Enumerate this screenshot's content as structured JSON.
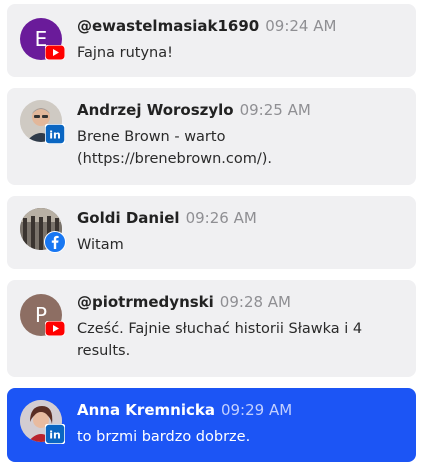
{
  "messages": [
    {
      "author": "@ewastelmasiak1690",
      "time": "09:24 AM",
      "text": "Fajna rutyna!",
      "avatar_letter": "E",
      "avatar_color": "#6a1b9a",
      "platform": "youtube-icon"
    },
    {
      "author": "Andrzej Woroszylo",
      "time": "09:25 AM",
      "text": "Brene Brown - warto (https://brenebrown.com/).",
      "avatar_letter": "",
      "platform": "linkedin-icon"
    },
    {
      "author": "Goldi Daniel",
      "time": "09:26 AM",
      "text": "Witam",
      "avatar_letter": "",
      "platform": "facebook-icon"
    },
    {
      "author": "@piotrmedynski",
      "time": "09:28 AM",
      "text": "Cześć. Fajnie słuchać historii Sławka i 4 results.",
      "avatar_letter": "P",
      "avatar_color": "#8d6e63",
      "platform": "youtube-icon"
    },
    {
      "author": "Anna Kremnicka",
      "time": "09:29 AM",
      "text": "to brzmi bardzo dobrze.",
      "avatar_letter": "",
      "platform": "linkedin-icon",
      "highlighted": true
    }
  ],
  "colors": {
    "card_bg": "#f0f0f2",
    "active_bg": "#1c55f5",
    "youtube": "#ff0000",
    "linkedin": "#0a66c2",
    "facebook": "#1877f2"
  }
}
